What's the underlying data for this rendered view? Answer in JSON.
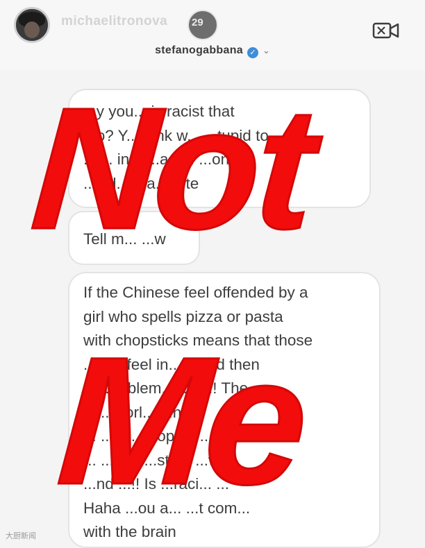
{
  "header": {
    "handle": "michaelitronova",
    "stories_count": "29",
    "title": "stefanogabbana",
    "verified_icon": "verified-badge-icon",
    "video_icon": "video-call-icon"
  },
  "messages": [
    "...y you... is racist that\n...o? Y... hink w... ...tupid to\n...i... in... ...a a... ...ong\n...vid... ...a... ...te",
    "Tell m... ...w",
    "If the Chinese feel offended by a\ngirl who spells pizza or pasta\nwith chopsticks means that those\n... ...e feel in... ...and then\n... ...roblem... ...s !!! The\n... ...worl... ...hat\n... ...e ... ...ops... ...and\n... ...at... ...ste... ...w\n...nd ...!! Is ...raci... ...\nHaha ...ou a... ...t com...\nwith the brain"
  ],
  "overlay": {
    "line1": "Not",
    "line2": "Me",
    "color": "#f20c0c"
  },
  "watermark": "大厨新闻"
}
